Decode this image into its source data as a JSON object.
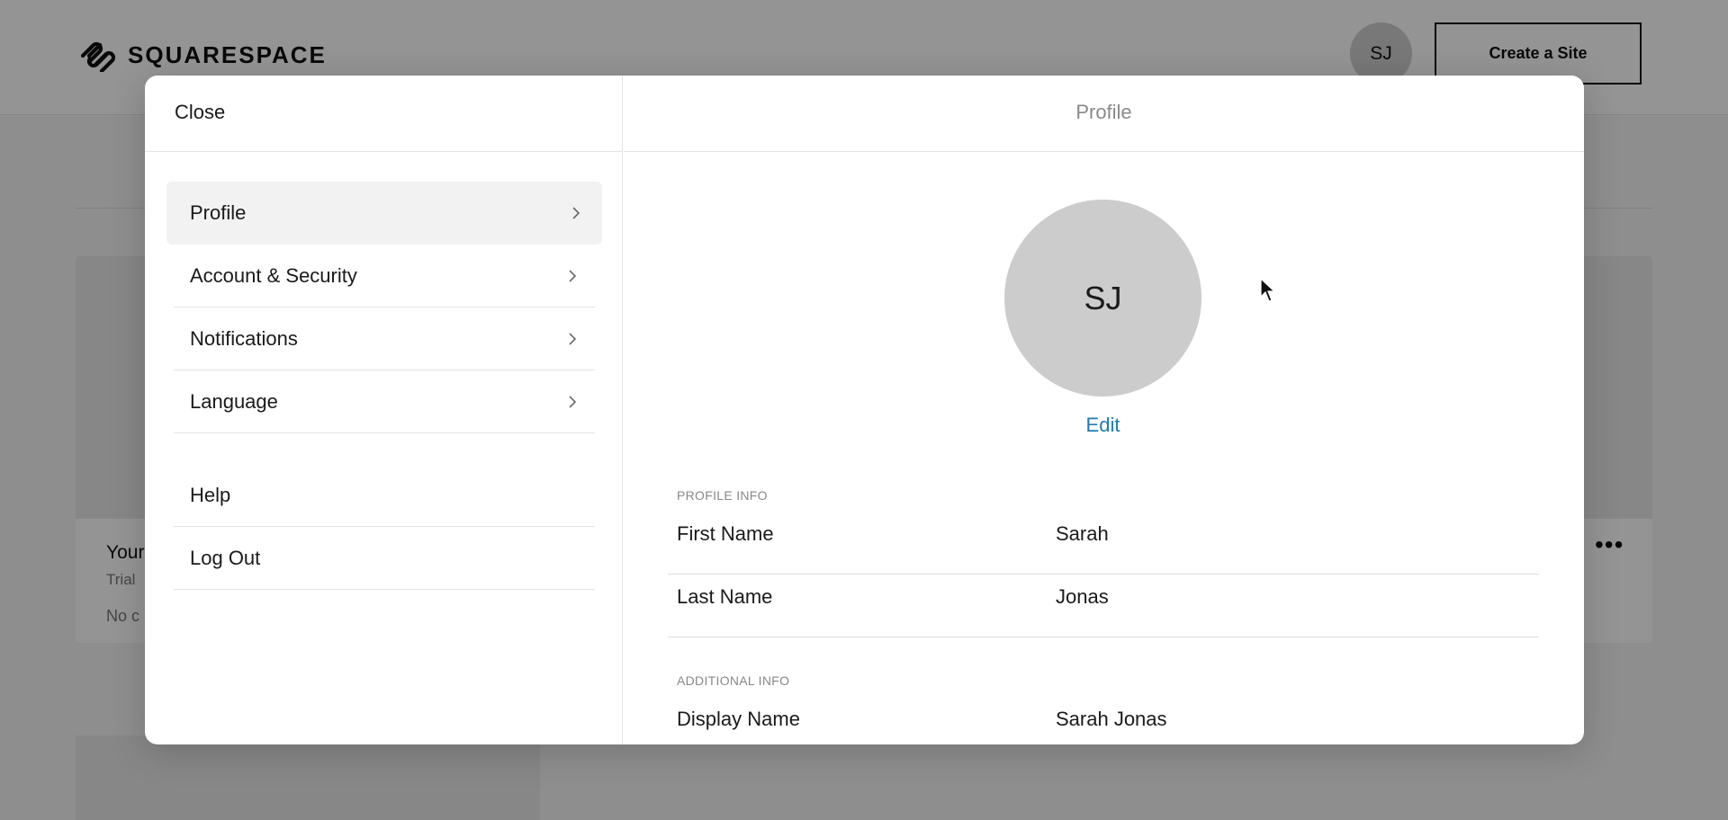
{
  "background": {
    "brand": "SQUARESPACE",
    "avatar_initials": "SJ",
    "create_site_label": "Create a Site",
    "site_card": {
      "title": "Your",
      "subtitle": "Trial",
      "note": "No c",
      "more_icon": "more-horizontal-icon"
    }
  },
  "modal": {
    "close_label": "Close",
    "panel_title": "Profile",
    "nav": {
      "items": [
        {
          "label": "Profile",
          "active": true
        },
        {
          "label": "Account & Security"
        },
        {
          "label": "Notifications"
        },
        {
          "label": "Language"
        }
      ],
      "secondary": [
        {
          "label": "Help"
        },
        {
          "label": "Log Out"
        }
      ]
    },
    "profile": {
      "avatar_initials": "SJ",
      "edit_label": "Edit",
      "profile_info_label": "PROFILE INFO",
      "first_name_label": "First Name",
      "first_name_value": "Sarah",
      "last_name_label": "Last Name",
      "last_name_value": "Jonas",
      "additional_info_label": "ADDITIONAL INFO",
      "display_name_label": "Display Name",
      "display_name_value": "Sarah Jonas"
    }
  },
  "colors": {
    "accent_link": "#1f7cae",
    "avatar_bg": "#cccccc",
    "overlay": "rgba(0,0,0,0.42)"
  }
}
